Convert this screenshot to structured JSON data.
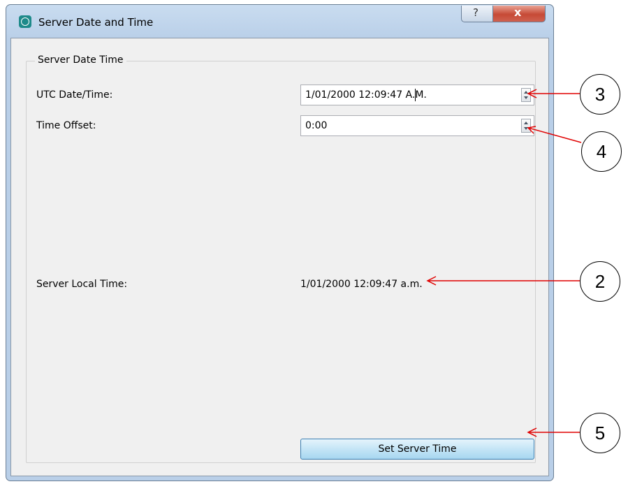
{
  "window": {
    "title": "Server Date and Time",
    "help_label": "?",
    "close_label": "x"
  },
  "group": {
    "legend": "Server Date Time",
    "utc_label": "UTC Date/Time:",
    "utc_value": "1/01/2000 12:09:47 A.M.",
    "offset_label": "Time Offset:",
    "offset_value": "0:00",
    "local_label": "Server Local Time:",
    "local_value": "1/01/2000 12:09:47 a.m.",
    "set_button_label": "Set Server Time"
  },
  "callouts": [
    "3",
    "4",
    "2",
    "5"
  ],
  "colors": {
    "arrow": "#e00000",
    "accent_button": "#c4e5f6",
    "close_button": "#c64a36"
  }
}
